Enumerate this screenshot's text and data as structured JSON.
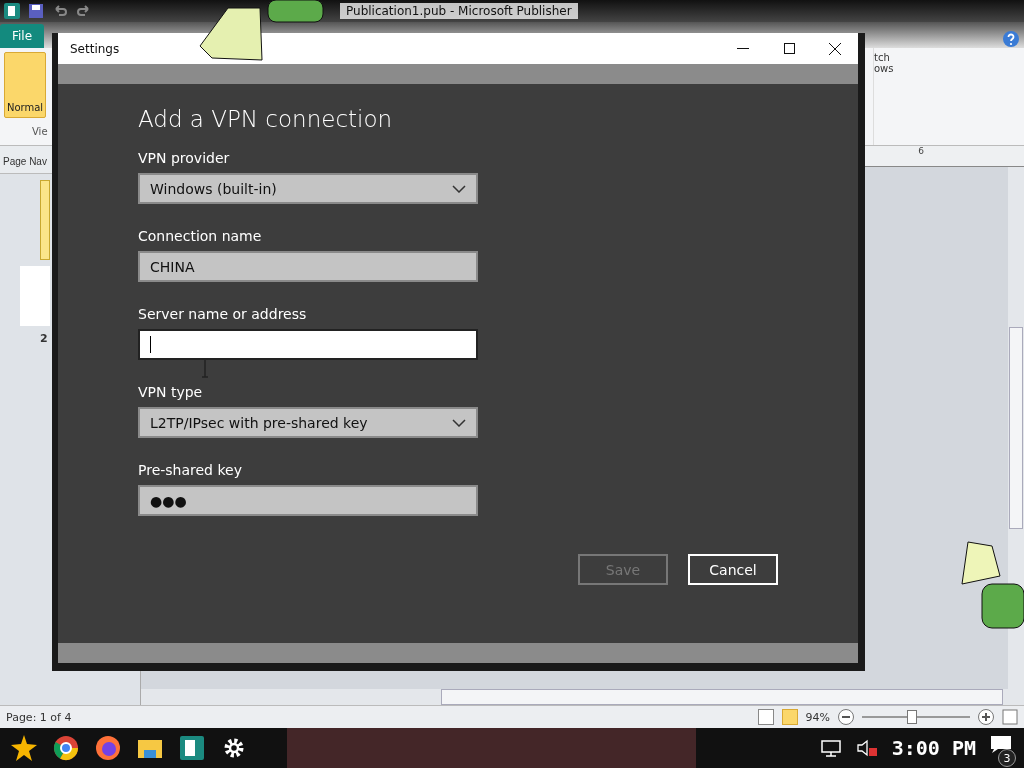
{
  "app_window": {
    "title": "Publication1.pub - Microsoft Publisher"
  },
  "ribbon": {
    "file_tab": "File",
    "normal_button": "Normal",
    "group_label": "Vie",
    "right_button_lines": [
      "tch",
      "ows"
    ]
  },
  "page_navigation": {
    "header": "Page Nav",
    "page_number": "2"
  },
  "ruler": {
    "label": "6"
  },
  "dialog": {
    "title": "Settings",
    "heading": "Add a VPN connection",
    "fields": [
      {
        "kind": "dropdown",
        "label": "VPN provider",
        "value": "Windows (built-in)",
        "focused": false
      },
      {
        "kind": "text",
        "label": "Connection name",
        "value": "CHINA",
        "focused": false
      },
      {
        "kind": "text",
        "label": "Server name or address",
        "focused": true
      },
      {
        "kind": "dropdown",
        "label": "VPN type",
        "value": "L2TP/IPsec with pre-shared key",
        "focused": false
      },
      {
        "kind": "text",
        "label": "Pre-shared key",
        "value": "●●●",
        "focused": false
      }
    ],
    "buttons": [
      {
        "label": "Save",
        "disabled": true
      },
      {
        "label": "Cancel",
        "disabled": false
      }
    ]
  },
  "status_bar": {
    "page": "Page: 1 of 4",
    "view_buttons": [
      {
        "selected": false
      },
      {
        "selected": true
      }
    ],
    "zoom": "94%",
    "zoom_slider": {
      "level": 0.45
    }
  },
  "taskbar": {
    "clock": "3:00 PM",
    "notification_count": "3"
  }
}
